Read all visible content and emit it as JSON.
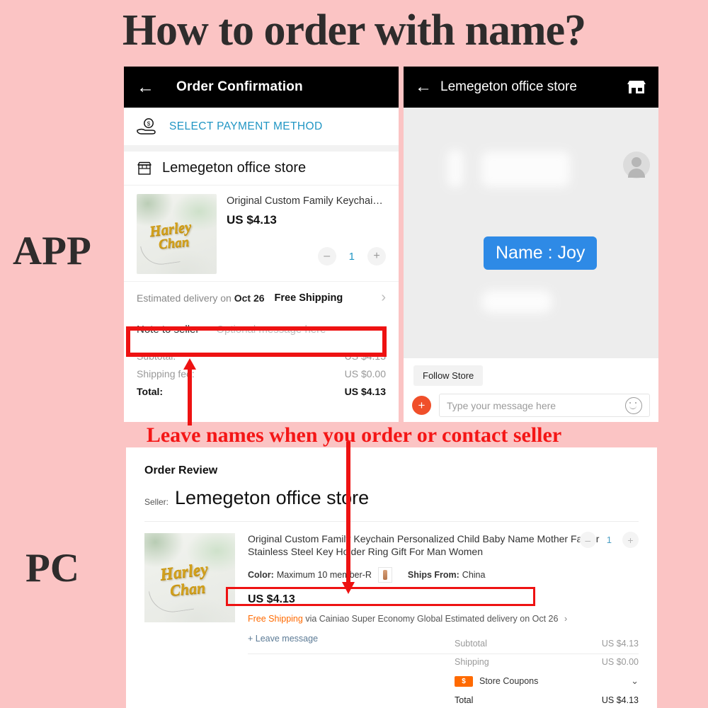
{
  "headline": "How to order with name?",
  "banner": "Leave names when you order or contact seller",
  "labels": {
    "app": "APP",
    "pc": "PC"
  },
  "colors": {
    "background_pink": "#fbc4c4",
    "annotation_red": "#ee1212",
    "banner_red": "#f41616",
    "link_blue": "#2196c4",
    "bubble_blue": "#2e8ae6",
    "accent_orange": "#ff6a00",
    "plus_orange": "#f04f2a"
  },
  "app_order": {
    "header": {
      "back_icon": "arrow-left-icon",
      "title": "Order Confirmation"
    },
    "payment": {
      "icon": "hand-money-icon",
      "label": "SELECT PAYMENT METHOD"
    },
    "store": {
      "icon": "store-icon",
      "name": "Lemegeton office store"
    },
    "product": {
      "title": "Original Custom Family Keychain ...",
      "price": "US $4.13",
      "thumb_script_1": "Harley",
      "thumb_script_2": "Chan",
      "qty": {
        "minus": "–",
        "value": "1",
        "plus": "+"
      }
    },
    "shipping": {
      "estimate_prefix": "Estimated delivery on",
      "estimate_date": "Oct 26",
      "free": "Free Shipping",
      "chevron": "›"
    },
    "note": {
      "label": "Note to seller",
      "placeholder": "Optional message here"
    },
    "totals": [
      {
        "label": "Subtotal:",
        "value": "US $4.13"
      },
      {
        "label": "Shipping fee:",
        "value": "US $0.00"
      },
      {
        "label": "Total:",
        "value": "US $4.13"
      }
    ]
  },
  "app_chat": {
    "header": {
      "back_icon": "arrow-left-icon",
      "title": "Lemegeton office store",
      "shop_icon": "store-icon"
    },
    "bubble": "Name : Joy",
    "follow_button": "Follow Store",
    "input": {
      "plus_icon": "plus-icon",
      "placeholder": "Type your message here",
      "emoji_icon": "smiley-icon"
    }
  },
  "pc_order": {
    "heading": "Order Review",
    "seller_label": "Seller:",
    "seller_name": "Lemegeton office store",
    "product": {
      "title": "Original Custom Family Keychain Personalized Child Baby Name Mother Father Stainless Steel Key Holder Ring Gift For Man Women",
      "color_label": "Color:",
      "color_value": "Maximum 10 member-R",
      "ships_label": "Ships From:",
      "ships_value": "China",
      "price": "US $4.13",
      "thumb_script_1": "Harley",
      "thumb_script_2": "Chan",
      "qty": {
        "minus": "–",
        "value": "1",
        "plus": "+"
      }
    },
    "shipping_line": {
      "free": "Free Shipping",
      "via": "via Cainiao Super Economy Global",
      "estimate": "Estimated delivery on Oct 26",
      "chevron": "›"
    },
    "leave_message": "+ Leave message",
    "totals": [
      {
        "label": "Subtotal",
        "value": "US $4.13"
      },
      {
        "label": "Shipping",
        "value": "US $0.00"
      }
    ],
    "coupon": {
      "badge": "$",
      "label": "Store Coupons",
      "chevron": "⌄"
    },
    "total": {
      "label": "Total",
      "value": "US $4.13"
    }
  }
}
